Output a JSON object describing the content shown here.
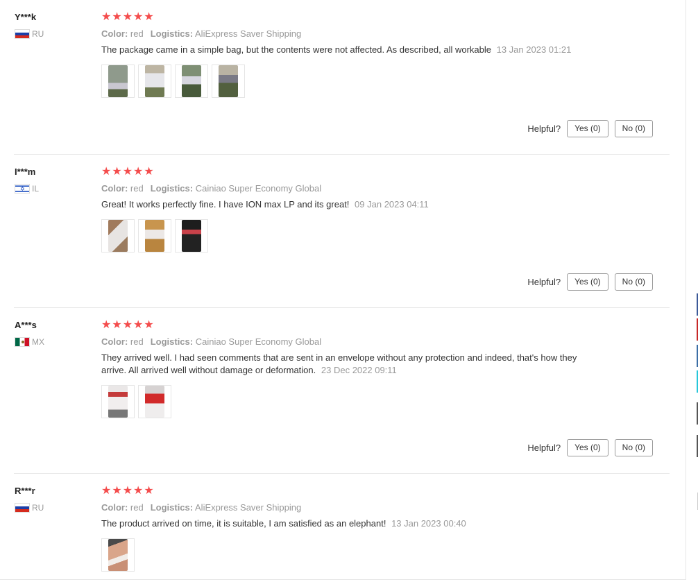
{
  "labels": {
    "color": "Color:",
    "logistics": "Logistics:",
    "helpful": "Helpful?"
  },
  "reviews": [
    {
      "user": "Y***k",
      "country": "RU",
      "stars": "★★★★★",
      "color": "red",
      "logistics": "AliExpress Saver Shipping",
      "text": "The package came in a simple bag, but the contents were not affected. As described, all workable",
      "date": "13 Jan 2023 01:21",
      "yes": "Yes (0)",
      "no": "No (0)"
    },
    {
      "user": "I***m",
      "country": "IL",
      "stars": "★★★★★",
      "color": "red",
      "logistics": "Cainiao Super Economy Global",
      "text": "Great! It works perfectly fine. I have ION max LP and its great!",
      "date": "09 Jan 2023 04:11",
      "yes": "Yes (0)",
      "no": "No (0)"
    },
    {
      "user": "A***s",
      "country": "MX",
      "stars": "★★★★★",
      "color": "red",
      "logistics": "Cainiao Super Economy Global",
      "text": "They arrived well. I had seen comments that are sent in an envelope without any protection and indeed, that's how they arrive. All arrived well without damage or deformation.",
      "date": "23 Dec 2022 09:11",
      "yes": "Yes (0)",
      "no": "No (0)"
    },
    {
      "user": "R***r",
      "country": "RU",
      "stars": "★★★★★",
      "color": "red",
      "logistics": "AliExpress Saver Shipping",
      "text": "The product arrived on time, it is suitable, I am satisfied as an elephant!",
      "date": "13 Jan 2023 00:40"
    }
  ],
  "colors": {
    "star": "#f44c4c",
    "muted": "#999999",
    "text": "#333333"
  }
}
